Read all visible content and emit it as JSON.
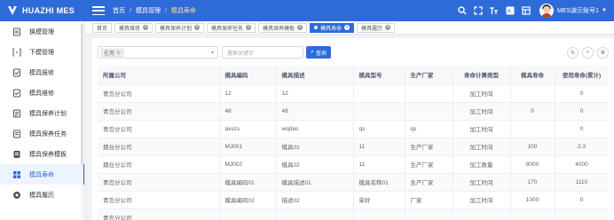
{
  "app": {
    "title": "HUAZHI MES"
  },
  "breadcrumb": {
    "items": [
      "首页",
      "模具管理",
      "模具寿命"
    ]
  },
  "user": {
    "name": "MES演示账号1"
  },
  "colors": {
    "primary": "#2f6bd8",
    "breadcrumb_current": "#ffe38a"
  },
  "sidebar": {
    "items": [
      {
        "label": "换模管理",
        "icon": "swap-icon"
      },
      {
        "label": "下模管理",
        "icon": "unload-icon"
      },
      {
        "label": "模具报修",
        "icon": "report-icon"
      },
      {
        "label": "模具维修",
        "icon": "repair-icon"
      },
      {
        "label": "模具保养计划",
        "icon": "plan-icon"
      },
      {
        "label": "模具保养任务",
        "icon": "task-icon"
      },
      {
        "label": "模具保养模板",
        "icon": "template-icon"
      },
      {
        "label": "模具寿命",
        "icon": "life-icon"
      },
      {
        "label": "模具履历",
        "icon": "history-icon"
      }
    ],
    "active_index": 7
  },
  "tabs": [
    {
      "label": "首页"
    },
    {
      "label": "模具维修"
    },
    {
      "label": "模具保养计划"
    },
    {
      "label": "模具保养任务"
    },
    {
      "label": "模具保养模板"
    },
    {
      "label": "模具寿命"
    },
    {
      "label": "模具履历"
    }
  ],
  "active_tab": 5,
  "filter": {
    "chip": "在用",
    "search_placeholder": "搜索关键字",
    "search_label": "查询"
  },
  "table": {
    "columns": [
      "所属公司",
      "模具编码",
      "模具描述",
      "模具型号",
      "生产厂家",
      "寿命计算类型",
      "模具寿命",
      "使用寿命(累计)"
    ],
    "rows": [
      [
        "青岛分公司",
        "12",
        "12",
        "",
        "",
        "加工时间",
        "",
        "0"
      ],
      [
        "青岛分公司",
        "48",
        "48",
        "",
        "",
        "加工时间",
        "0",
        "0"
      ],
      [
        "青岛分公司",
        "axszs",
        "wqdas",
        "qs",
        "qs",
        "加工时间",
        "",
        "0"
      ],
      [
        "烟台分公司",
        "MJ001",
        "模具01",
        "11",
        "生产厂家",
        "加工时间",
        "100",
        "2.3"
      ],
      [
        "烟台分公司",
        "MJ002",
        "模具02",
        "11",
        "生产厂家",
        "加工数量",
        "9000",
        "4000"
      ],
      [
        "青岛分公司",
        "模具编码01",
        "模具描述01",
        "模具名称01",
        "生产厂家",
        "加工时间",
        "170",
        "1110"
      ],
      [
        "青岛分公司",
        "模具编码02",
        "描述02",
        "单好",
        "厂家",
        "加工时间",
        "1000",
        "0"
      ],
      [
        "青岛分公司",
        "",
        "",
        "",
        "",
        "",
        "",
        ""
      ]
    ]
  }
}
